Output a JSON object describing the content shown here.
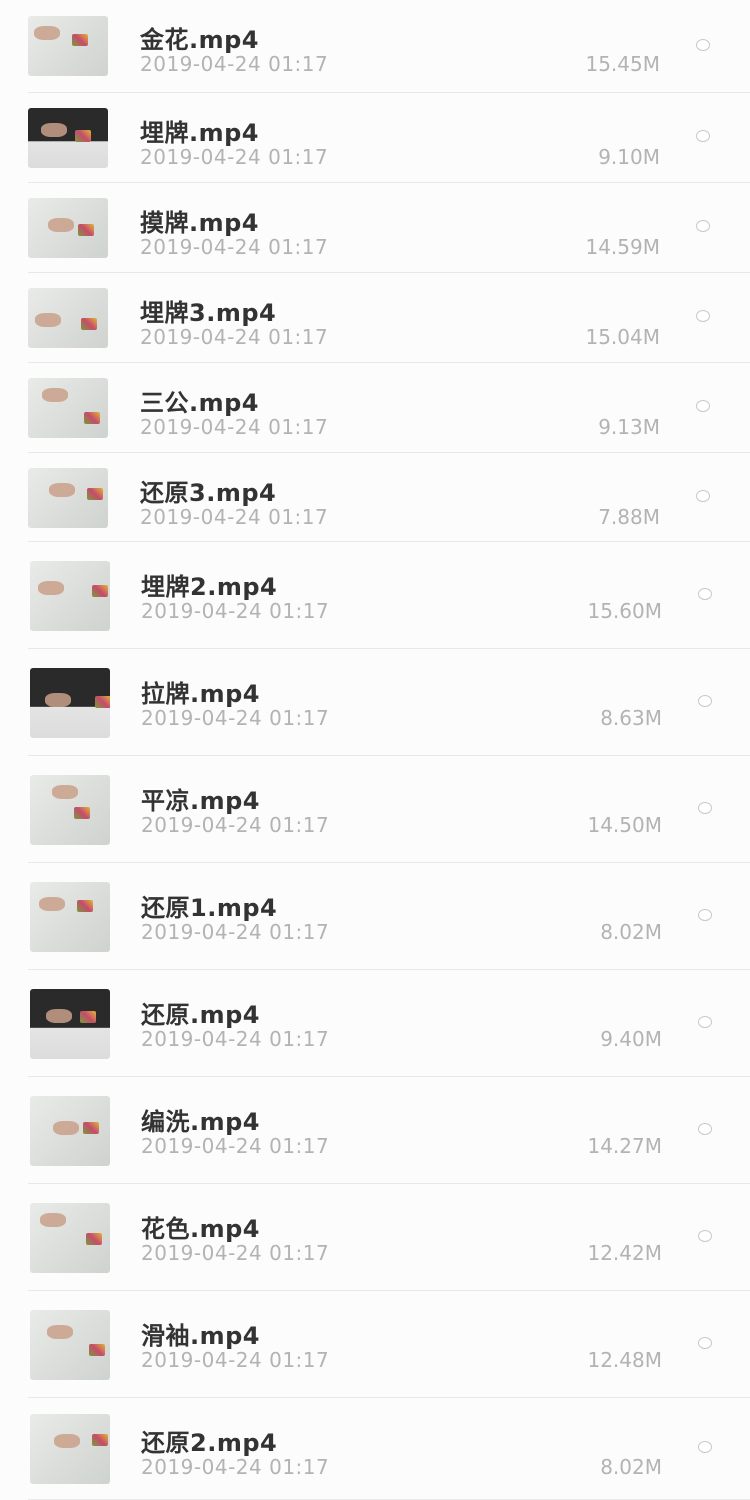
{
  "files": [
    {
      "name": "金花.mp4",
      "date": "2019-04-24 01:17",
      "size": "15.45M"
    },
    {
      "name": "埋牌.mp4",
      "date": "2019-04-24 01:17",
      "size": "9.10M"
    },
    {
      "name": "摸牌.mp4",
      "date": "2019-04-24 01:17",
      "size": "14.59M"
    },
    {
      "name": "埋牌3.mp4",
      "date": "2019-04-24 01:17",
      "size": "15.04M"
    },
    {
      "name": "三公.mp4",
      "date": "2019-04-24 01:17",
      "size": "9.13M"
    },
    {
      "name": "还原3.mp4",
      "date": "2019-04-24 01:17",
      "size": "7.88M"
    },
    {
      "name": "埋牌2.mp4",
      "date": "2019-04-24 01:17",
      "size": "15.60M"
    },
    {
      "name": "拉牌.mp4",
      "date": "2019-04-24 01:17",
      "size": "8.63M"
    },
    {
      "name": "平凉.mp4",
      "date": "2019-04-24 01:17",
      "size": "14.50M"
    },
    {
      "name": "还原1.mp4",
      "date": "2019-04-24 01:17",
      "size": "8.02M"
    },
    {
      "name": "还原.mp4",
      "date": "2019-04-24 01:17",
      "size": "9.40M"
    },
    {
      "name": "编洗.mp4",
      "date": "2019-04-24 01:17",
      "size": "14.27M"
    },
    {
      "name": "花色.mp4",
      "date": "2019-04-24 01:17",
      "size": "12.42M"
    },
    {
      "name": "滑袖.mp4",
      "date": "2019-04-24 01:17",
      "size": "12.48M"
    },
    {
      "name": "还原2.mp4",
      "date": "2019-04-24 01:17",
      "size": "8.02M"
    }
  ],
  "icons": {
    "thumbnail": "video-thumbnail",
    "select": "radio-circle-icon"
  },
  "colors": {
    "accent_frame": "#7a3fe0",
    "title_text": "#333333",
    "meta_text": "#b3b3b3"
  }
}
